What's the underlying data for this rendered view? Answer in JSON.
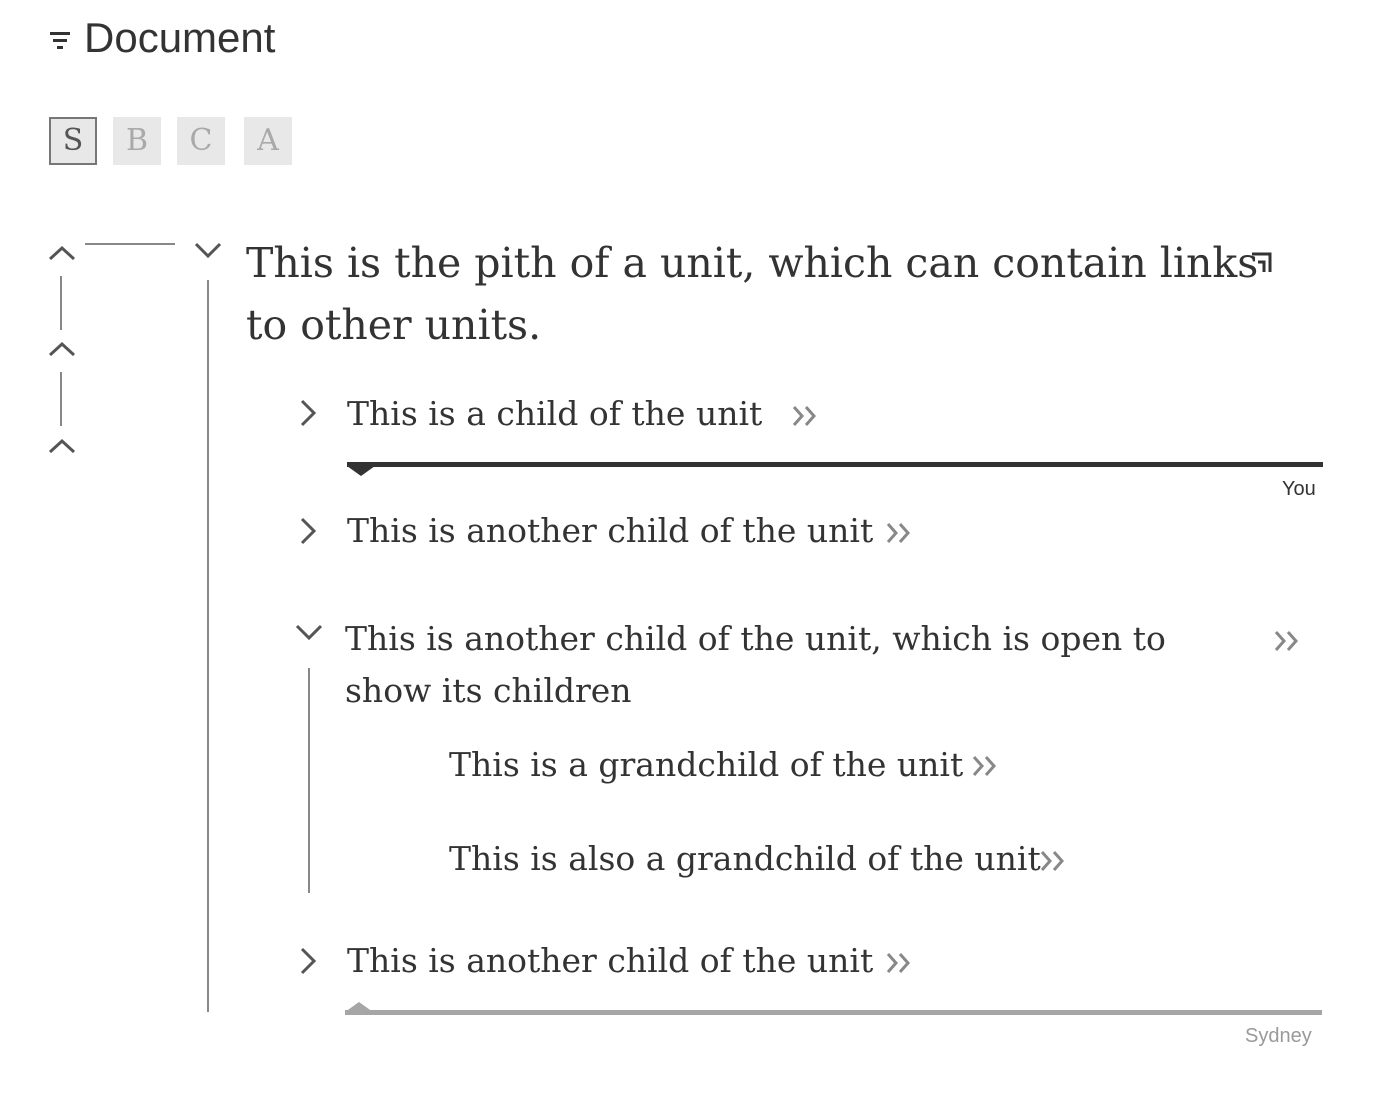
{
  "header": {
    "title": "Document",
    "filter_icon": "filter-icon"
  },
  "view_modes": [
    "S",
    "B",
    "C",
    "A"
  ],
  "active_view_mode": "S",
  "unit": {
    "pith": "This is the pith of a unit, which can contain links to other units.",
    "link_icon": "link-corner-icon",
    "children": [
      {
        "text": "This is a child of the unit",
        "expanded": false
      },
      {
        "text": "This is another child of the unit",
        "expanded": false
      },
      {
        "text": "This is another child of the unit, which is open to show its children",
        "expanded": true,
        "children": [
          {
            "text": "This is a grandchild of the unit"
          },
          {
            "text": "This is also a grandchild of the unit"
          }
        ]
      },
      {
        "text": "This is another child of the unit",
        "expanded": false
      }
    ]
  },
  "presence": {
    "you_label": "You",
    "other_label": "Sydney"
  },
  "colors": {
    "text": "#333333",
    "muted": "#888888",
    "you_bar": "#333333",
    "other_bar": "#a6a6a6"
  }
}
